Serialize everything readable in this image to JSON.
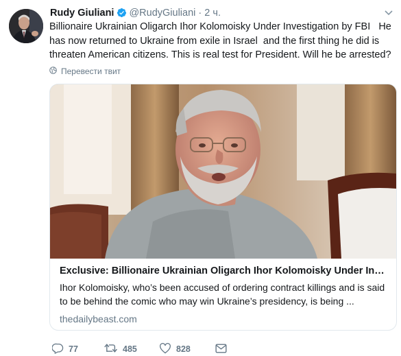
{
  "tweet": {
    "author_name": "Rudy Giuliani",
    "handle": "@RudyGiuliani",
    "separator": "·",
    "time": "2 ч.",
    "text": "Billionaire Ukrainian Oligarch Ihor Kolomoisky Under Investigation by FBI   He has now returned to Ukraine from exile in Israel  and the first thing he did is threaten American citizens. This is real test for President. Will he be arrested?",
    "translate_label": "Перевести твит"
  },
  "card": {
    "title": "Exclusive: Billionaire Ukrainian Oligarch Ihor Kolomoisky Under Inves...",
    "description": "Ihor Kolomoisky, who’s been accused of ordering contract killings and is said to be behind the comic who may win Ukraine’s presidency, is being ...",
    "domain": "thedailybeast.com"
  },
  "actions": {
    "replies": "77",
    "retweets": "485",
    "likes": "828"
  },
  "colors": {
    "text": "#14171a",
    "secondary": "#657786",
    "verified": "#1da1f2",
    "border": "#e1e8ed"
  }
}
